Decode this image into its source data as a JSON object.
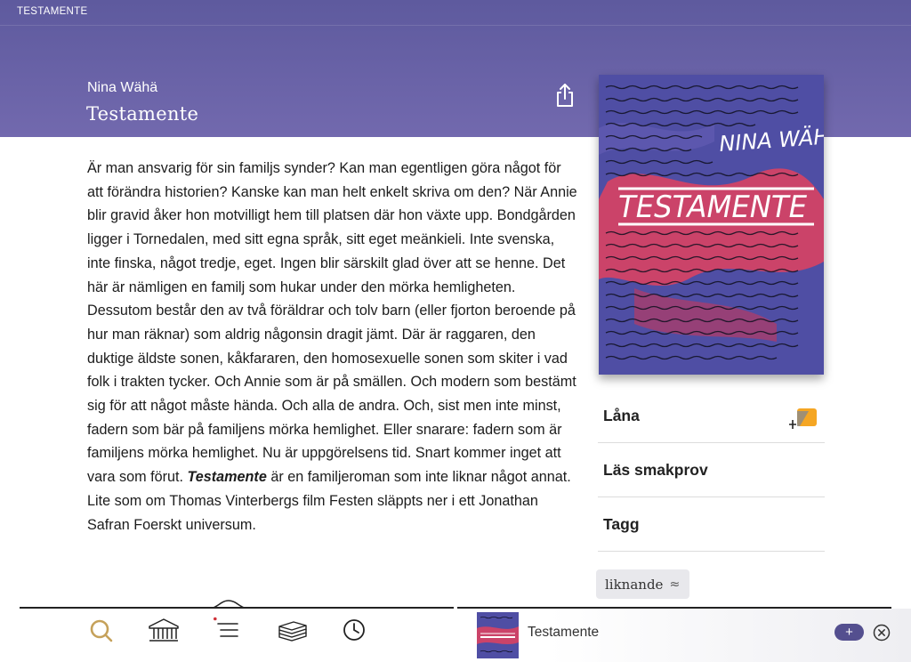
{
  "status": {
    "app_title": "TESTAMENTE"
  },
  "book": {
    "author": "Nina Wähä",
    "title": "Testamente",
    "description_part1": "Är man ansvarig för sin familjs synder? Kan man egentligen göra något för att förändra historien? Kanske kan man helt enkelt skriva om den? När Annie blir gravid åker hon motvilligt hem till platsen där hon växte upp. Bondgården ligger i Tornedalen, med sitt egna språk, sitt eget meänkieli. Inte svenska, inte finska, något tredje, eget. Ingen blir särskilt glad över att se henne. Det här är nämligen en familj som hukar under den mörka hemligheten. Dessutom består den av två föräldrar och tolv barn (eller fjorton beroende på hur man räknar) som aldrig någonsin dragit jämt. Där är raggaren, den duktige äldste sonen, kåkfararen, den homosexuelle sonen som skiter i vad folk i trakten tycker. Och Annie som är på smällen. Och modern som bestämt sig för att något måste hända. Och alla de andra. Och, sist men inte minst, fadern som bär på familjens mörka hemlighet. Eller snarare: fadern som är familjens mörka hemlighet. Nu är uppgörelsens tid. Snart kommer inget att vara som förut. ",
    "description_emph": "Testamente",
    "description_part2": " är en familjeroman som inte liknar något annat. Lite som om Thomas Vinterbergs film Festen släppts ner i ett Jonathan Safran Foerskt universum.",
    "cover": {
      "author_text": "NINA WÄHÄ",
      "title_text": "TESTAMENTE",
      "background_color": "#4f4ea4",
      "accent_color": "#e0425f"
    }
  },
  "actions": {
    "loan": "Låna",
    "sample": "Läs smakprov",
    "tags": "Tagg"
  },
  "similar": {
    "label": "liknande",
    "symbol": "≈"
  },
  "bottom_nav": {
    "items": [
      {
        "icon": "search-icon"
      },
      {
        "icon": "library-icon"
      },
      {
        "icon": "menu-list-icon"
      },
      {
        "icon": "books-stack-icon"
      },
      {
        "icon": "clock-icon"
      }
    ]
  },
  "player": {
    "title": "Testamente",
    "plus_label": "+",
    "close_symbol": "✕"
  },
  "colors": {
    "header": "#6a64a8",
    "accent_orange": "#f5a623",
    "search_icon": "#c5a15a",
    "notification_dot": "#d0323a",
    "button": "#544f8f"
  }
}
